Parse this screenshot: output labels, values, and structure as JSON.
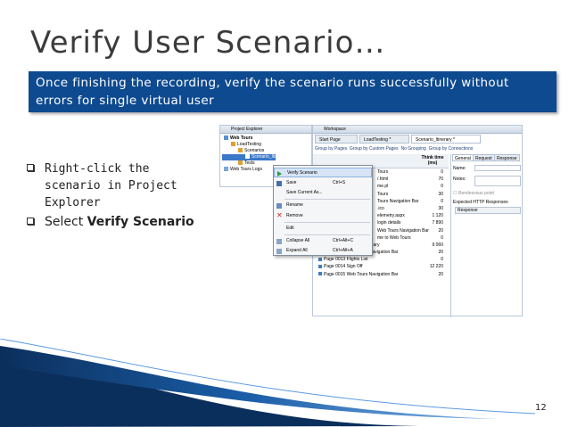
{
  "slide": {
    "title": "Verify User Scenario…",
    "banner": "Once finishing the recording, verify the scenario runs successfully without errors for single virtual user",
    "bullets": [
      {
        "text": "Right-click the scenario  in Project Explorer"
      },
      {
        "prefix": "Select ",
        "strong": "Verify Scenario"
      }
    ],
    "page_number": "12"
  },
  "screenshot": {
    "project_explorer": {
      "title": "Project Explorer",
      "tree": [
        "Web Tours",
        "LoadTesting",
        "Scenarios",
        "Scenario_Itinerary",
        "Tests",
        "Web Tours Logs"
      ]
    },
    "workspace": {
      "title": "Workspace",
      "tabs": [
        "Start Page",
        "LoadTesting *",
        "Scenario_Itinerary *"
      ],
      "toolbar": [
        "Group by Pages",
        "Group by Custom Pages",
        "No Grouping",
        "Group by Connections"
      ],
      "grid_header": "Think time (ms)",
      "rows": [
        {
          "name": "Tours",
          "value": "0"
        },
        {
          "name": "/.html",
          "value": "70"
        },
        {
          "name": "me.pl",
          "value": "0"
        },
        {
          "name": "Tours",
          "value": "30"
        },
        {
          "name": "Tours Navigation Bar",
          "value": "0"
        },
        {
          "name": ".ico",
          "value": "30"
        },
        {
          "name": "elemetry.aspx",
          "value": "1 120"
        },
        {
          "name": "login details",
          "value": "7 890"
        },
        {
          "name": "Web Tours Navigation Bar",
          "value": "20"
        },
        {
          "name": "me to Web Tours",
          "value": "0"
        },
        {
          "name": "Page 0011 Click on Itinerary",
          "value": "9 060"
        },
        {
          "name": "Page 0012 Web Tours Navigation Bar",
          "value": "20"
        },
        {
          "name": "Page 0013 Flights List",
          "value": "0"
        },
        {
          "name": "Page 0014 Sign Off",
          "value": "12 220"
        },
        {
          "name": "Page 0015 Web Tours Navigation Bar",
          "value": "20"
        }
      ],
      "props_tabs": [
        "General",
        "Request",
        "Response"
      ],
      "props": {
        "name_label": "Name:",
        "notes_label": "Notes:",
        "rendezvous_label": "Rendezvous point",
        "expected_label": "Expected HTTP Responses",
        "response_label": "Response"
      }
    },
    "context_menu": {
      "items": [
        {
          "label": "Verify Scenario",
          "shortcut": ""
        },
        {
          "label": "Save",
          "shortcut": "Ctrl+S"
        },
        {
          "label": "Save Current As...",
          "shortcut": ""
        },
        {
          "label": "Rename",
          "shortcut": ""
        },
        {
          "label": "Remove",
          "shortcut": ""
        },
        {
          "label": "Edit",
          "shortcut": ""
        },
        {
          "label": "Collapse All",
          "shortcut": "Ctrl+Alt+C"
        },
        {
          "label": "Expand All",
          "shortcut": "Ctrl+Alt+A"
        }
      ]
    }
  },
  "colors": {
    "banner": "#0e4a8f",
    "wave_dark": "#0b2f5c",
    "wave_light": "#2e7bc8"
  }
}
